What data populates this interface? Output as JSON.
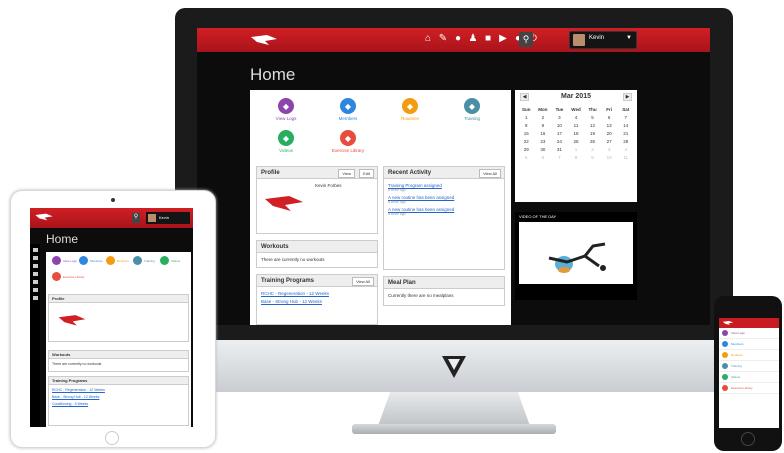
{
  "desktop": {
    "user_name": "Kevin",
    "page_title": "Home",
    "quick_links": [
      {
        "label": "View Logs",
        "color": "#8e44ad",
        "icon": "chart-icon"
      },
      {
        "label": "Members",
        "color": "#2e86de",
        "icon": "members-icon"
      },
      {
        "label": "Routines",
        "color": "#f39c12",
        "icon": "routines-icon"
      },
      {
        "label": "Training",
        "color": "#4a90a4",
        "icon": "training-icon"
      },
      {
        "label": "Videos",
        "color": "#27ae60",
        "icon": "videos-icon"
      },
      {
        "label": "Exercise Library",
        "color": "#e74c3c",
        "icon": "library-icon"
      }
    ],
    "profile": {
      "title": "Profile",
      "name": "Kevin Forbes",
      "btn_view": "View",
      "btn_edit": "Edit"
    },
    "recent_activity": {
      "title": "Recent Activity",
      "btn": "View All",
      "items": [
        {
          "link": "Training Program assigned",
          "meta": "a while ago"
        },
        {
          "link": "A new routine has been assigned",
          "meta": "a while ago"
        },
        {
          "link": "A new routine has been assigned",
          "meta": "a while ago"
        }
      ]
    },
    "workouts": {
      "title": "Workouts",
      "text": "There are currently no workouts"
    },
    "training_programs": {
      "title": "Training Programs",
      "btn": "View All",
      "items": [
        "RCHC - Regeneration - 12 Weeks",
        "Base - Strong Hub - 12 Weeks"
      ]
    },
    "meal_plan": {
      "title": "Meal Plan",
      "text": "Currently there are no mealplans"
    },
    "calendar": {
      "month": "Mar 2015",
      "days": [
        "Sun",
        "Mon",
        "Tue",
        "Wed",
        "Thu",
        "Fri",
        "Sat"
      ],
      "weeks": [
        [
          "1",
          "2",
          "3",
          "4",
          "5",
          "6",
          "7"
        ],
        [
          "8",
          "9",
          "10",
          "11",
          "12",
          "13",
          "14"
        ],
        [
          "15",
          "16",
          "17",
          "18",
          "19",
          "20",
          "21"
        ],
        [
          "22",
          "23",
          "24",
          "25",
          "26",
          "27",
          "28"
        ],
        [
          "29",
          "30",
          "31",
          "1",
          "2",
          "3",
          "4"
        ],
        [
          "5",
          "6",
          "7",
          "8",
          "9",
          "10",
          "11"
        ]
      ]
    },
    "video_of_day": "VIDEO OF THE DAY"
  },
  "tablet": {
    "page_title": "Home",
    "user_name": "Kevin",
    "profile_title": "Profile",
    "workouts_title": "Workouts",
    "workouts_text": "There are currently no workouts",
    "training_title": "Training Programs",
    "training_items": [
      "RCHC - Regeneration - 12 Weeks",
      "Base - Strong Hub - 12 Weeks",
      "Conditioning - 6 Weeks"
    ]
  },
  "phone": {
    "items": [
      {
        "label": "View Logs",
        "color": "#8e44ad"
      },
      {
        "label": "Members",
        "color": "#2e86de"
      },
      {
        "label": "Routines",
        "color": "#f39c12"
      },
      {
        "label": "Training",
        "color": "#4a90a4"
      },
      {
        "label": "Videos",
        "color": "#27ae60"
      },
      {
        "label": "Exercise Library",
        "color": "#e74c3c"
      }
    ]
  }
}
